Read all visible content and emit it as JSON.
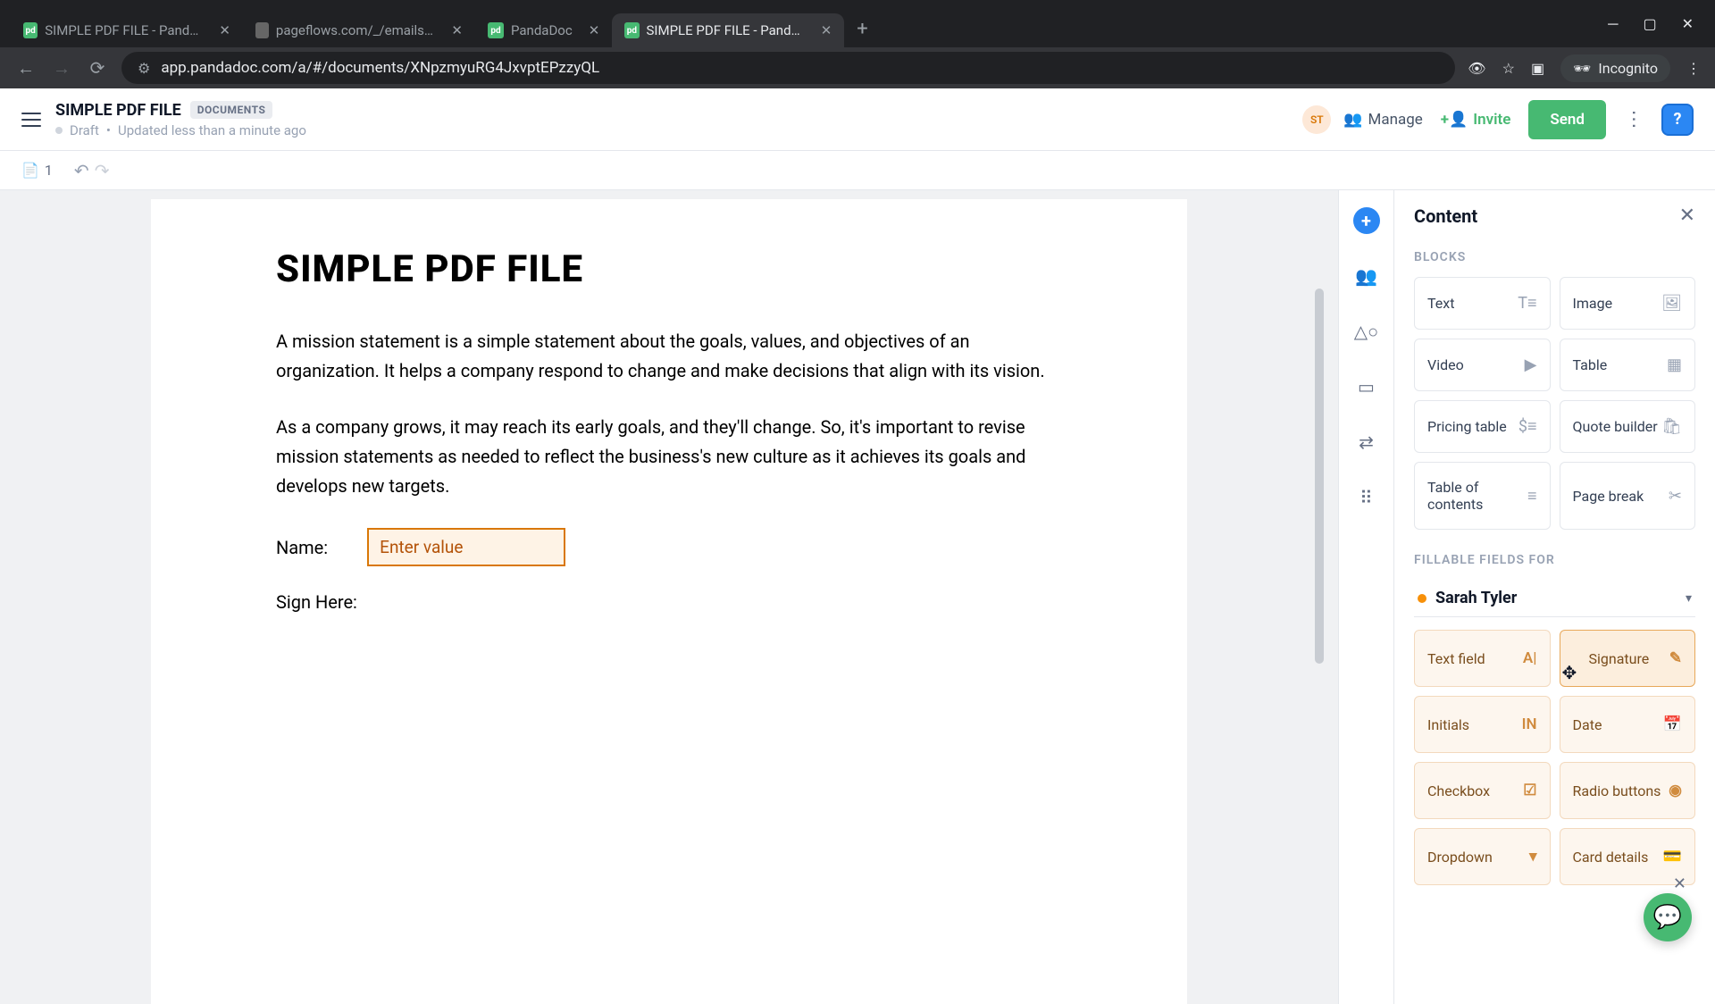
{
  "browser": {
    "tabs": [
      {
        "title": "SIMPLE PDF FILE - PandaDoc",
        "active": false
      },
      {
        "title": "pageflows.com/_/emails/_/7fb5",
        "active": false
      },
      {
        "title": "PandaDoc",
        "active": false
      },
      {
        "title": "SIMPLE PDF FILE - PandaDoc",
        "active": true
      }
    ],
    "url": "app.pandadoc.com/a/#/documents/XNpzmyuRG4JxvptEPzzyQL",
    "incognito_label": "Incognito"
  },
  "header": {
    "doc_title": "SIMPLE PDF FILE",
    "doc_badge": "DOCUMENTS",
    "status_text": "Draft",
    "updated_text": "Updated less than a minute ago",
    "avatar_initials": "ST",
    "manage_label": "Manage",
    "invite_label": "Invite",
    "send_label": "Send"
  },
  "toolbar": {
    "page_count": "1"
  },
  "document": {
    "heading": "SIMPLE PDF FILE",
    "para1": "A mission statement is a simple statement about the goals, values, and objectives of an organization. It helps a company respond to change and make decisions that align with its vision.",
    "para2": "As a company grows, it may reach its early goals, and they'll change. So, it's important to revise mission statements as needed to reflect the business's new culture as it achieves its goals and develops new targets.",
    "name_label": "Name:",
    "name_placeholder": "Enter value",
    "sign_label": "Sign Here:"
  },
  "panel": {
    "title": "Content",
    "blocks_label": "BLOCKS",
    "blocks": {
      "text": "Text",
      "image": "Image",
      "video": "Video",
      "table": "Table",
      "pricing_table": "Pricing table",
      "quote_builder": "Quote builder",
      "toc": "Table of contents",
      "page_break": "Page break"
    },
    "fillable_label": "FILLABLE FIELDS FOR",
    "assignee": "Sarah Tyler",
    "fields": {
      "text_field": "Text field",
      "signature": "Signature",
      "initials": "Initials",
      "date": "Date",
      "checkbox": "Checkbox",
      "radio": "Radio buttons",
      "dropdown": "Dropdown",
      "card": "Card details"
    }
  }
}
